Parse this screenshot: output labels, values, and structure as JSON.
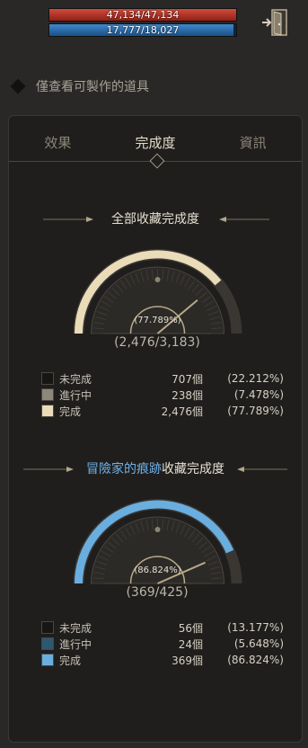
{
  "status": {
    "hp": {
      "text": "47,134/47,134",
      "fraction": 1.0
    },
    "mp": {
      "text": "17,777/18,027",
      "fraction": 0.986
    }
  },
  "exit_icon": "exit-door-icon",
  "filter": {
    "label": "僅查看可製作的道具",
    "checked": false
  },
  "tabs": [
    {
      "label": "效果"
    },
    {
      "label": "完成度",
      "active": true
    },
    {
      "label": "資訊"
    }
  ],
  "overall": {
    "title": "全部收藏完成度",
    "percent": "(77.789%)",
    "count": "(2,476/3,183)",
    "fraction": 0.77789,
    "colors": {
      "incomplete": "#171614",
      "progress": "#8d867b",
      "complete": "#eadbb9"
    },
    "legend": [
      {
        "label": "未完成",
        "count": "707個",
        "percent": "(22.212%)"
      },
      {
        "label": "進行中",
        "count": "238個",
        "percent": "(7.478%)"
      },
      {
        "label": "完成",
        "count": "2,476個",
        "percent": "(77.789%)"
      }
    ]
  },
  "adventure": {
    "title_highlight": "冒險家的痕跡",
    "title_rest": "收藏完成度",
    "percent": "(86.824%)",
    "count": "(369/425)",
    "fraction": 0.86824,
    "colors": {
      "incomplete": "#171614",
      "progress": "#2e5870",
      "complete": "#6aaee0"
    },
    "legend": [
      {
        "label": "未完成",
        "count": "56個",
        "percent": "(13.177%)"
      },
      {
        "label": "進行中",
        "count": "24個",
        "percent": "(5.648%)"
      },
      {
        "label": "完成",
        "count": "369個",
        "percent": "(86.824%)"
      }
    ]
  }
}
